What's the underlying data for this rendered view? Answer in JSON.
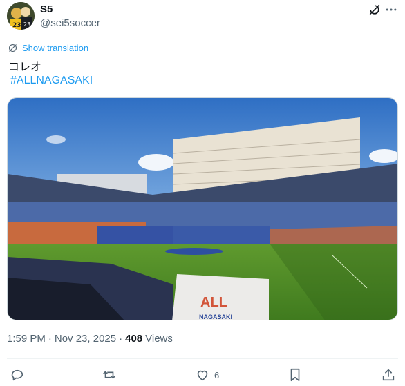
{
  "post": {
    "author": {
      "display_name": "S5",
      "handle": "@sei5soccer",
      "avatar": "avatar-icon"
    },
    "show_translation_label": "Show translation",
    "text": "コレオ",
    "hashtag": "#ALLNAGASAKI",
    "media": {
      "banner_text_1": "ALL",
      "banner_text_2": "NAGASAKI"
    },
    "time": "1:59 PM",
    "date": "Nov 23, 2025",
    "separator_1": "·",
    "separator_2": "·",
    "views_count": "408",
    "views_label": "Views"
  },
  "actions": {
    "like_count": "6",
    "icons": [
      "reply-icon",
      "repost-icon",
      "like-icon",
      "bookmark-icon",
      "share-icon"
    ]
  },
  "colors": {
    "accent": "#1d9bf0",
    "secondary_text": "#536471",
    "primary_text": "#0f1419"
  }
}
